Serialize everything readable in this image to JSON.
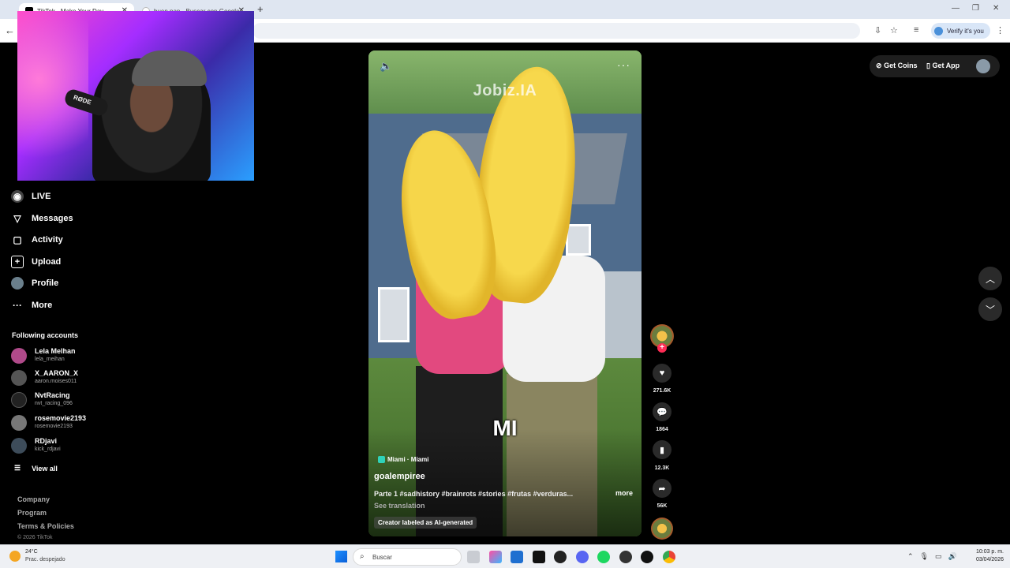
{
  "browser": {
    "tabs": [
      {
        "title": "TikTok - Make Your Day"
      },
      {
        "title": "buen pan - Buscar con Google"
      }
    ],
    "verify_label": "Verify it's you"
  },
  "webcam": {
    "mic_brand": "RØDE"
  },
  "sidebar": {
    "nav": [
      {
        "label": "LIVE",
        "icon": "live-icon"
      },
      {
        "label": "Messages",
        "icon": "messages-icon"
      },
      {
        "label": "Activity",
        "icon": "activity-icon"
      },
      {
        "label": "Upload",
        "icon": "upload-icon"
      },
      {
        "label": "Profile",
        "icon": "profile-icon"
      },
      {
        "label": "More",
        "icon": "more-icon"
      }
    ],
    "following_title": "Following accounts",
    "accounts": [
      {
        "name": "Lela Melhan",
        "handle": "lela_meihan"
      },
      {
        "name": "X_AARON_X",
        "handle": "aaron.moises011"
      },
      {
        "name": "NvtRacing",
        "handle": "nvt_racing_096"
      },
      {
        "name": "rosemovie2193",
        "handle": "rosemovie2193"
      },
      {
        "name": "RDjavi",
        "handle": "kick_rdjavi"
      }
    ],
    "view_all": "View all",
    "footer": [
      "Company",
      "Program",
      "Terms & Policies"
    ],
    "copyright": "© 2026 TikTok"
  },
  "video": {
    "watermark": "Jobiz.IA",
    "caption_big": "MI",
    "location": "Miami · Miami",
    "author": "goalempiree",
    "description": "Parte 1 #sadhistory #brainrots #stories #frutas #verduras...",
    "more": "more",
    "see_translation": "See translation",
    "ai_label": "Creator labeled as AI-generated"
  },
  "actions": {
    "likes": "271.6K",
    "comments": "1864",
    "saves": "12.3K",
    "shares": "56K"
  },
  "header": {
    "get_coins": "Get Coins",
    "get_app": "Get App"
  },
  "taskbar": {
    "weather_temp": "24°C",
    "weather_desc": "Prac. despejado",
    "search_placeholder": "Buscar",
    "time": "10:03 p. m.",
    "date": "03/04/2026"
  },
  "colors": {
    "tiktok_red": "#fe2c55",
    "background": "#000000"
  }
}
